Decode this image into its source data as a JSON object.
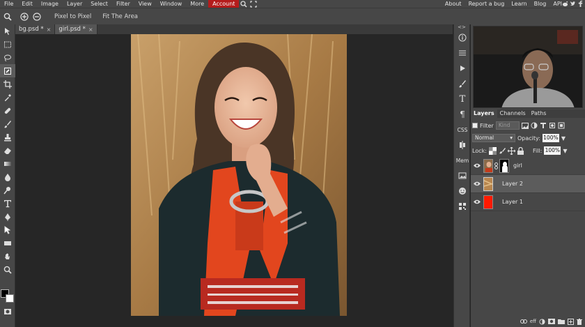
{
  "menu": {
    "items": [
      "File",
      "Edit",
      "Image",
      "Layer",
      "Select",
      "Filter",
      "View",
      "Window",
      "More",
      "Account"
    ],
    "right_items": [
      "About",
      "Report a bug",
      "Learn",
      "Blog",
      "API"
    ]
  },
  "options": {
    "pixel_to_pixel": "Pixel to Pixel",
    "fit_area": "Fit The Area"
  },
  "tabs": [
    {
      "label": "bg.psd *",
      "close": "×"
    },
    {
      "label": "girl.psd *",
      "close": "×"
    }
  ],
  "midcol": {
    "css_label": "CSS",
    "mem_label": "Mem",
    "collapse": "<>"
  },
  "layers_panel": {
    "tabs": [
      "Layers",
      "Channels",
      "Paths"
    ],
    "filter_label": "Filter",
    "kind_placeholder": "Kind",
    "blend_mode": "Normal",
    "opacity_label": "Opacity:",
    "opacity_value": "100%",
    "lock_label": "Lock:",
    "fill_label": "Fill:",
    "fill_value": "100%",
    "layers": [
      {
        "name": "girl",
        "selected": false
      },
      {
        "name": "Layer 2",
        "selected": true
      },
      {
        "name": "Layer 1",
        "selected": false
      }
    ],
    "bottom_eff": "eff"
  },
  "colors": {
    "accent": "#b41c1c",
    "foreground": "#000000",
    "background": "#ffffff",
    "layer1_fill": "#ff1a00"
  }
}
